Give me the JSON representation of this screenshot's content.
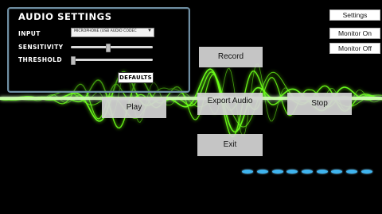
{
  "audio_settings": {
    "title": "AUDIO SETTINGS",
    "input_label": "INPUT",
    "input_value": "MICROPHONE (USB AUDIO CODEC",
    "sensitivity_label": "SENSITIVITY",
    "sensitivity_value": 0.45,
    "threshold_label": "THRESHOLD",
    "threshold_value": 0.0,
    "defaults_label": "DEFAULTS"
  },
  "buttons": {
    "record": "Record",
    "play": "Play",
    "export_audio": "Export Audio",
    "stop": "Stop",
    "exit": "Exit"
  },
  "top_right": {
    "settings": "Settings",
    "monitor_on": "Monitor On",
    "monitor_off": "Monitor Off"
  },
  "colors": {
    "background": "#000000",
    "waveform": "#6dff1a",
    "panel_border": "#6f8fa3",
    "level_dots": "#3fb4ef"
  },
  "icons": {
    "dropdown": "chevron-down-icon",
    "level_meter": "level-dot-icon"
  }
}
